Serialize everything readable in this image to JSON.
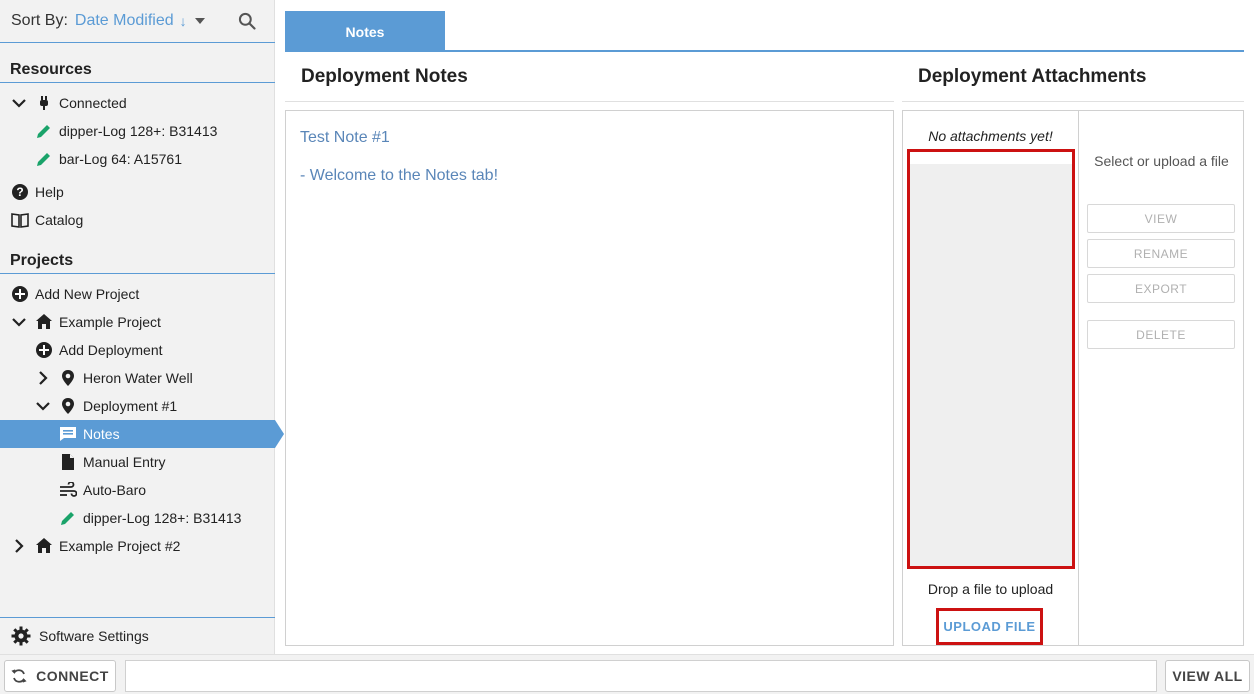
{
  "sort": {
    "label": "Sort By:",
    "value": "Date Modified",
    "direction_glyph": "↓"
  },
  "sidebar": {
    "resources_title": "Resources",
    "resources": [
      {
        "label": "Connected",
        "icon": "plug-icon"
      },
      {
        "label": "dipper-Log 128+: B31413",
        "icon": "pencil-icon"
      },
      {
        "label": "bar-Log 64: A15761",
        "icon": "pencil-icon"
      },
      {
        "label": "Help",
        "icon": "help-icon"
      },
      {
        "label": "Catalog",
        "icon": "book-icon"
      }
    ],
    "projects_title": "Projects",
    "projects": [
      {
        "label": "Add New Project",
        "icon": "plus-circle-icon"
      },
      {
        "label": "Example Project",
        "icon": "home-icon"
      },
      {
        "label": "Add Deployment",
        "icon": "plus-circle-icon"
      },
      {
        "label": "Heron Water Well",
        "icon": "map-pin-icon"
      },
      {
        "label": "Deployment #1",
        "icon": "map-pin-icon"
      },
      {
        "label": "Notes",
        "icon": "notes-icon"
      },
      {
        "label": "Manual Entry",
        "icon": "document-icon"
      },
      {
        "label": "Auto-Baro",
        "icon": "wind-icon"
      },
      {
        "label": "dipper-Log 128+: B31413",
        "icon": "pencil-icon"
      },
      {
        "label": "Example Project #2",
        "icon": "home-icon"
      }
    ],
    "settings_label": "Software Settings"
  },
  "tabs": [
    {
      "label": "Notes",
      "active": true
    }
  ],
  "notes": {
    "title": "Deployment Notes",
    "lines": [
      "Test Note #1",
      "- Welcome to the Notes tab!"
    ]
  },
  "attachments": {
    "title": "Deployment Attachments",
    "empty_text": "No attachments yet!",
    "drop_text": "Drop a file to upload",
    "upload_label": "UPLOAD FILE",
    "hint": "Select or upload a file",
    "actions": [
      "VIEW",
      "RENAME",
      "EXPORT",
      "DELETE"
    ]
  },
  "bottom": {
    "connect_label": "CONNECT",
    "status_text": "",
    "view_all_label": "VIEW ALL"
  },
  "colors": {
    "accent": "#5b9bd5",
    "pencil": "#1aa36a",
    "highlight_border": "#cc1111"
  }
}
